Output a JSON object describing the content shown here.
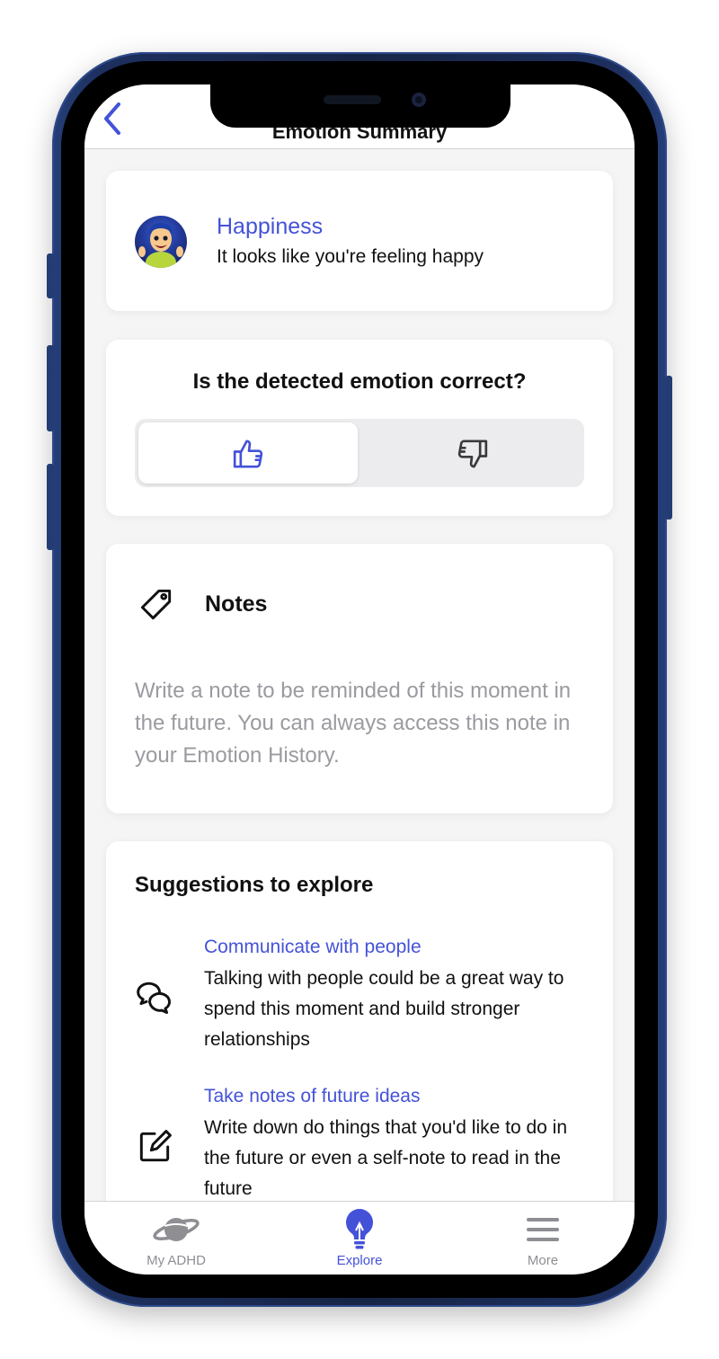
{
  "nav": {
    "title": "Emotion Summary"
  },
  "emotion": {
    "name": "Happiness",
    "description": "It looks like you're feeling happy"
  },
  "feedback": {
    "question": "Is the detected emotion correct?",
    "selected": "yes"
  },
  "notes": {
    "title": "Notes",
    "placeholder": "Write a note to be reminded of this moment in the future. You can always access this note in your Emotion History."
  },
  "suggestions": {
    "heading": "Suggestions to explore",
    "items": [
      {
        "icon": "chat-bubbles-icon",
        "title": "Communicate with people",
        "description": "Talking with people could be a great way to spend this moment and build stronger relationships"
      },
      {
        "icon": "edit-note-icon",
        "title": "Take notes of future ideas",
        "description": "Write down do things that you'd like to do in the future or even a self-note to read in the future"
      }
    ]
  },
  "tabbar": {
    "tabs": [
      {
        "label": "My ADHD",
        "icon": "planet-icon",
        "active": false
      },
      {
        "label": "Explore",
        "icon": "lightbulb-icon",
        "active": true
      },
      {
        "label": "More",
        "icon": "menu-icon",
        "active": false
      }
    ]
  },
  "colors": {
    "accent": "#4452d8",
    "frame": "#1d2f5e",
    "muted": "#8e8e93"
  }
}
